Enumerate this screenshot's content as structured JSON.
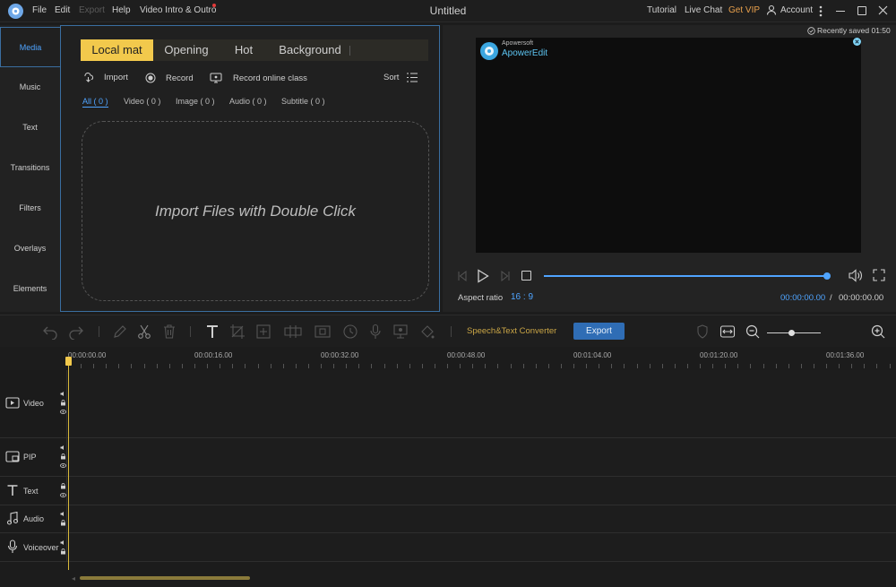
{
  "app": {
    "title": "Untitled",
    "menu": [
      "File",
      "Edit",
      "Export",
      "Help",
      "Video Intro & Outro"
    ],
    "right_links": [
      "Tutorial",
      "Live Chat",
      "Get VIP",
      "Account"
    ],
    "recently_saved": "Recently saved 01:50"
  },
  "sidebar": {
    "items": [
      {
        "label": "Media",
        "active": true
      },
      {
        "label": "Music"
      },
      {
        "label": "Text"
      },
      {
        "label": "Transitions"
      },
      {
        "label": "Filters"
      },
      {
        "label": "Overlays"
      },
      {
        "label": "Elements"
      }
    ]
  },
  "media": {
    "tabs": [
      "Local mat",
      "Opening",
      "Hot",
      "Background"
    ],
    "actions": {
      "import": "Import",
      "record": "Record",
      "record_online": "Record online class",
      "sort": "Sort"
    },
    "filters": [
      "All ( 0 )",
      "Video ( 0 )",
      "Image ( 0 )",
      "Audio ( 0 )",
      "Subtitle ( 0 )"
    ],
    "dropzone": "Import Files with Double Click"
  },
  "preview": {
    "watermark_top": "Apowersoft",
    "watermark_name": "ApowerEdit",
    "aspect_label": "Aspect ratio",
    "aspect_value": "16 : 9",
    "time_current": "00:00:00.00",
    "time_sep": "/",
    "time_total": "00:00:00.00"
  },
  "timeline": {
    "speech_converter": "Speech&Text Converter",
    "export": "Export",
    "ruler": [
      "00:00:00.00",
      "00:00:16.00",
      "00:00:32.00",
      "00:00:48.00",
      "00:01:04.00",
      "00:01:20.00",
      "00:01:36.00"
    ],
    "tracks": [
      "Video",
      "PIP",
      "Text",
      "Audio",
      "Voiceover"
    ]
  },
  "colors": {
    "accent_blue": "#4fa4ff",
    "accent_yellow": "#f2c94c",
    "vip_orange": "#e8a04c",
    "export_blue": "#2f6db5"
  }
}
